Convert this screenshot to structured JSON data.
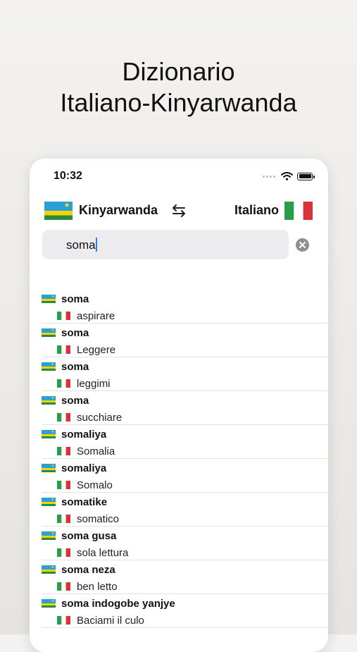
{
  "headline": {
    "line1": "Dizionario",
    "line2": "Italiano-Kinyarwanda"
  },
  "status_bar": {
    "time": "10:32"
  },
  "language_bar": {
    "source_language": "Kinyarwanda",
    "target_language": "Italiano",
    "source_flag": "rwanda-flag-icon",
    "target_flag": "italy-flag-icon",
    "swap_icon": "swap-arrows-icon"
  },
  "search": {
    "value": "soma",
    "clear_icon": "clear-circle-icon"
  },
  "colors": {
    "caret": "#2d7cf6",
    "search_bg": "#ececee",
    "separator": "#e2e2e4"
  },
  "results": [
    {
      "term": "soma",
      "translation": "aspirare"
    },
    {
      "term": "soma",
      "translation": "Leggere"
    },
    {
      "term": "soma",
      "translation": "leggimi"
    },
    {
      "term": "soma",
      "translation": "succhiare"
    },
    {
      "term": "somaliya",
      "translation": "Somalia"
    },
    {
      "term": "somaliya",
      "translation": "Somalo"
    },
    {
      "term": "somatike",
      "translation": "somatico"
    },
    {
      "term": "soma gusa",
      "translation": "sola lettura"
    },
    {
      "term": "soma neza",
      "translation": "ben letto"
    },
    {
      "term": "soma indogobe yanjye",
      "translation": "Baciami il culo"
    }
  ]
}
